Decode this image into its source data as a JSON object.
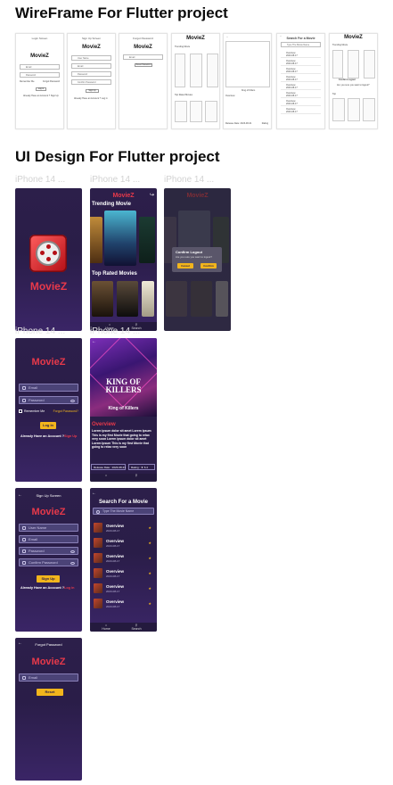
{
  "sections": {
    "wireframe_title": "WireFrame For Flutter project",
    "ui_title": "UI Design For Flutter project"
  },
  "wireframes": {
    "login": {
      "header": "Login Screen",
      "logo": "MovieZ",
      "email": "Email",
      "password": "Password",
      "remember": "Remember Me",
      "forgot": "Forgot Password",
      "login": "Log in",
      "signup_prompt": "Already Have an Account ? Sign Up"
    },
    "signup": {
      "header": "Sign Up Screen",
      "logo": "MovieZ",
      "username": "User Name",
      "email": "Email",
      "password": "Password",
      "confirm": "Confirm Password",
      "signup": "Sign Up",
      "login_prompt": "Already Have an Account ? Log in"
    },
    "forgot": {
      "header": "Forgot Password",
      "logo": "MovieZ",
      "email": "Email",
      "reset": "Reset Password"
    },
    "home": {
      "logo": "MovieZ",
      "trending": "Trending Movie",
      "top_rated": "Top Rated Movies"
    },
    "details": {
      "title": "King of Killers",
      "overview": "Overview",
      "release": "Release Date: 2023-08-31",
      "rating": "Rating"
    },
    "search": {
      "title": "Search For a Movie",
      "placeholder": "Type The Movie Name",
      "item_title": "Overview",
      "item_date": "2023-08-17"
    },
    "logout": {
      "logo": "MovieZ",
      "trending": "Trending Movie",
      "confirm_title": "Confirm Logout",
      "confirm_text": "Are you sure you want to logout?",
      "top": "Top"
    }
  },
  "phone_labels": {
    "p1": "iPhone 14 ...",
    "p2": "iPhone 14 ...",
    "p3": "iPhone 14 ...",
    "p4": "iPhone 14 ...",
    "p5": "iPhone 14 ..."
  },
  "splash": {
    "logo": "MovieZ"
  },
  "home": {
    "logo": "MovieZ",
    "trending": "Trending Movie",
    "top_rated": "Top Rated Movies",
    "nav_home": "Home",
    "nav_search": "Search"
  },
  "logout_dialog": {
    "logo": "MovieZ",
    "title": "Confirm Logout",
    "text": "Are you sure you want to logout?",
    "cancel": "Cancel",
    "confirm": "Confirm"
  },
  "login": {
    "logo": "MovieZ",
    "email_placeholder": "Email",
    "password_placeholder": "Password",
    "remember": "Remember Me",
    "forgot": "Forgot Password?",
    "login_btn": "Log in",
    "prompt": "Already Have an Account ?",
    "signup_link": "Sign Up"
  },
  "details": {
    "poster_title": "KING OF KILLERS",
    "poster_sub": "King of Killers",
    "overview_label": "Overview",
    "overview_text": "Lorem ipsum dolor sit amet Lorem Ipsum This is my first Movie that going to relax very soon Lorem ipsum dolor sit amet Lorem Ipsum This is my first Movie that going to relax very soon",
    "release": "Release Date : 2023-08-31",
    "rating": "Rating : ★ 6.4"
  },
  "signup": {
    "header": "Sign Up Screen",
    "logo": "MovieZ",
    "username": "User Name",
    "email": "Email",
    "password": "Password",
    "confirm": "Confirm Password",
    "btn": "Sign Up",
    "prompt": "Already Have an Account ?",
    "login_link": "Log in"
  },
  "search": {
    "title": "Search For a Movie",
    "placeholder": "Type The Movie Name",
    "items": [
      {
        "title": "Overview",
        "date": "2023-08-17"
      },
      {
        "title": "Overview",
        "date": "2023-08-17"
      },
      {
        "title": "Overview",
        "date": "2023-08-17"
      },
      {
        "title": "Overview",
        "date": "2023-08-17"
      },
      {
        "title": "Overview",
        "date": "2023-08-17"
      },
      {
        "title": "Overview",
        "date": "2023-08-17"
      }
    ],
    "nav_home": "Home",
    "nav_search": "Search"
  },
  "forgot": {
    "header": "Forgot Password",
    "logo": "MovieZ",
    "email": "Email",
    "btn": "Reset Password"
  },
  "colors": {
    "accent_red": "#e8394a",
    "accent_yellow": "#f2b51c",
    "bg_purple": "#2c1f4a"
  }
}
